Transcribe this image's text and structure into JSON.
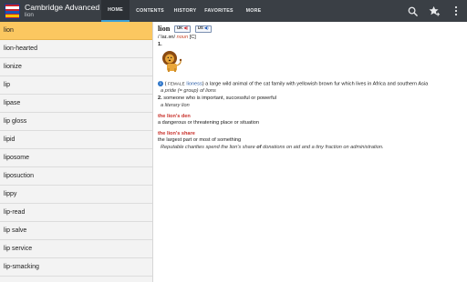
{
  "app": {
    "title": "Cambridge Advanced",
    "subtitle": "lion"
  },
  "tabs": [
    {
      "label": "HOME",
      "active": true
    },
    {
      "label": "CONTENTS",
      "active": false
    },
    {
      "label": "HISTORY",
      "active": false
    },
    {
      "label": "FAVORITES",
      "active": false
    },
    {
      "label": "MORE",
      "active": false
    }
  ],
  "actions": [
    "search-icon",
    "favorite-add-icon",
    "overflow-menu-icon"
  ],
  "word_list": {
    "selected_index": 0,
    "items": [
      "lion",
      "lion-hearted",
      "lionize",
      "lip",
      "lipase",
      "lip gloss",
      "lipid",
      "liposome",
      "liposuction",
      "lippy",
      "lip-read",
      "lip salve",
      "lip service",
      "lip-smacking"
    ]
  },
  "entry": {
    "headword": "lion",
    "audio_uk": "UK",
    "audio_us": "US",
    "pron": "/ˈlaɪ.ən/",
    "pos": "noun",
    "gram": "[C]",
    "sense1": {
      "num": "1.",
      "open": "(",
      "label": "FEMALE",
      "xref": "lioness",
      "def": ") a large wild animal of the cat family with yellowish brown fur which lives in Africa and southern Asia",
      "example": "a pride (= group) of lions"
    },
    "sense2": {
      "num": "2.",
      "def": "someone who is important, successful or powerful",
      "example": "a literary lion"
    },
    "phrase1": {
      "title": "the lion's den",
      "def": "a dangerous or threatening place or situation"
    },
    "phrase2": {
      "title": "the lion's share",
      "def": "the largest part or most of something",
      "example_pre": "Reputable charities spend the lion's share",
      "example_bold": "of",
      "example_post": "donations on aid and a tiny fraction on administration."
    }
  },
  "colors": {
    "topbar": "#3a3f45",
    "tab_indicator": "#3aa0d8",
    "selected_item": "#fbc760",
    "list_bg": "#f3f3f3",
    "pos": "#c8462a",
    "phrase": "#c8302a",
    "xref": "#2b5da6"
  }
}
